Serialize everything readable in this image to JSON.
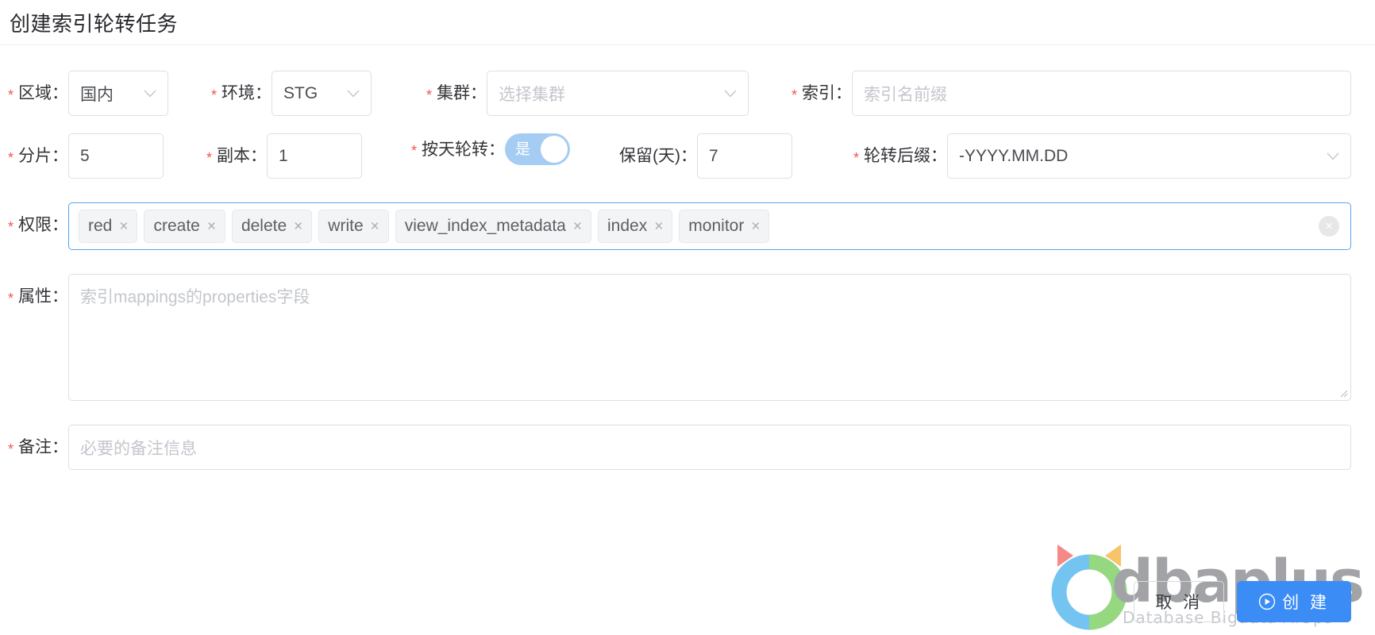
{
  "header": {
    "title": "创建索引轮转任务"
  },
  "form": {
    "row1": {
      "region": {
        "label": "区域：",
        "required": true,
        "value": "国内",
        "caret": "chevron-down-icon"
      },
      "environment": {
        "label": "环境：",
        "required": true,
        "value": "STG",
        "caret": "chevron-down-icon"
      },
      "cluster": {
        "label": "集群：",
        "required": true,
        "value": "",
        "placeholder": "选择集群",
        "caret": "chevron-down-icon"
      },
      "index": {
        "label": "索引：",
        "required": true,
        "value": "",
        "placeholder": "索引名前缀"
      }
    },
    "row2": {
      "shards": {
        "label": "分片：",
        "required": true,
        "value": "5"
      },
      "replicas": {
        "label": "副本：",
        "required": true,
        "value": "1"
      },
      "rotate_daily": {
        "label": "按天轮转：",
        "required": true,
        "state_text": "是",
        "on": true
      },
      "retention": {
        "label": "保留(天)：",
        "required": false,
        "value": "7"
      },
      "rotate_suffix": {
        "label": "轮转后缀：",
        "required": true,
        "value": "-YYYY.MM.DD",
        "caret": "chevron-down-icon"
      }
    },
    "permissions": {
      "label": "权限：",
      "required": true,
      "tags": [
        "red",
        "create",
        "delete",
        "write",
        "view_index_metadata",
        "index",
        "monitor"
      ],
      "tag_remove_icon": "×",
      "clear_icon": "×"
    },
    "properties": {
      "label": "属性：",
      "required": true,
      "value": "",
      "placeholder": "索引mappings的properties字段"
    },
    "remark": {
      "label": "备注：",
      "required": true,
      "value": "",
      "placeholder": "必要的备注信息"
    }
  },
  "footer": {
    "cancel_label": "取 消",
    "create_label": "创 建",
    "create_icon": "play-circle-icon"
  },
  "watermark": {
    "brand": "dbaplus",
    "tagline": "Database  Bigdata  AiOps"
  },
  "colors": {
    "required_star": "#f5544c",
    "primary_blue": "#3b8cf5",
    "focus_border": "#54a4f2",
    "switch_on": "#a5cdf3",
    "border": "#dcdfe6",
    "placeholder": "#c3c6cc"
  }
}
